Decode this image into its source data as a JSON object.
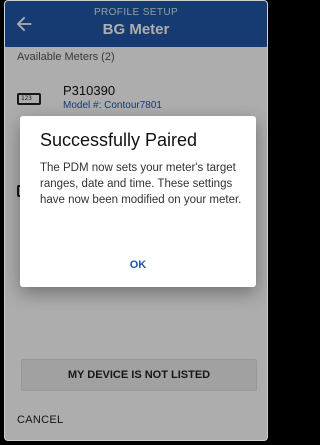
{
  "header": {
    "subtitle": "PROFILE SETUP",
    "title": "BG Meter"
  },
  "available_meters_label": "Available Meters (2)",
  "meters": [
    {
      "serial": "P310390",
      "model": "Model #: Contour7801",
      "icon_text": "123"
    },
    {
      "serial": "",
      "model": "",
      "icon_text": ""
    }
  ],
  "not_listed_label": "MY DEVICE IS NOT LISTED",
  "cancel_label": "CANCEL",
  "dialog": {
    "title": "Successfully Paired",
    "body": "The PDM now sets your meter's target ranges, date and time. These settings have now been modified on your meter.",
    "ok_label": "OK"
  },
  "colors": {
    "primary": "#1f58a8",
    "scrim": "rgba(0,0,0,0.32)"
  }
}
